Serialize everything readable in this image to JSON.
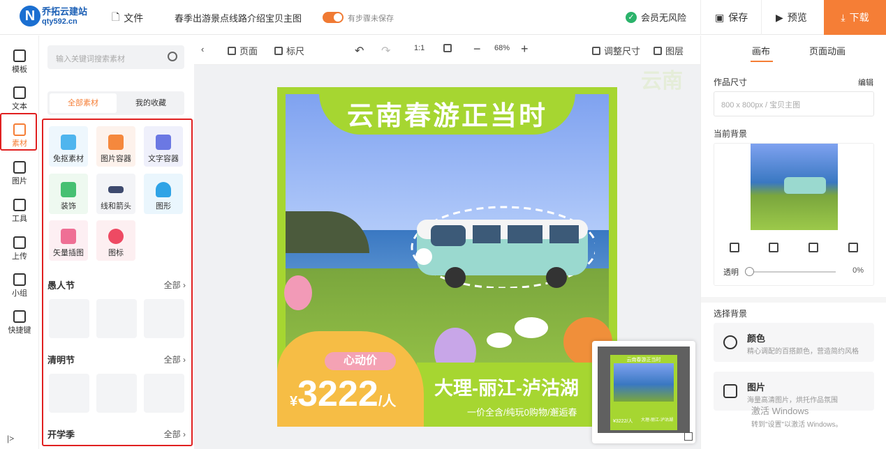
{
  "header": {
    "brand_name": "乔拓云建站",
    "brand_domain": "qty592.cn",
    "file_menu": "文件",
    "doc_name": "春季出游景点线路介绍宝贝主图",
    "unsaved": "有步骤未保存",
    "member_status": "会员无风险",
    "save": "保存",
    "preview": "预览",
    "download": "下载"
  },
  "rail": [
    {
      "label": "模板",
      "icon": "template-icon"
    },
    {
      "label": "文本",
      "icon": "text-icon"
    },
    {
      "label": "素材",
      "icon": "material-icon"
    },
    {
      "label": "图片",
      "icon": "image-icon"
    },
    {
      "label": "工具",
      "icon": "toolbox-icon"
    },
    {
      "label": "上传",
      "icon": "upload-icon"
    },
    {
      "label": "小组",
      "icon": "group-icon"
    },
    {
      "label": "快捷键",
      "icon": "keyboard-icon"
    }
  ],
  "panel": {
    "search_placeholder": "输入关键词搜索素材",
    "tab_all": "全部素材",
    "tab_fav": "我的收藏",
    "tiles": [
      "免抠素材",
      "图片容器",
      "文字容器",
      "装饰",
      "线和箭头",
      "图形",
      "矢量插图",
      "图标"
    ],
    "sections": [
      {
        "title": "愚人节",
        "more": "全部"
      },
      {
        "title": "清明节",
        "more": "全部"
      },
      {
        "title": "开学季",
        "more": "全部"
      }
    ]
  },
  "toolbar": {
    "page": "页面",
    "ruler": "标尺",
    "ratio": "1:1",
    "zoom": "68%",
    "resize": "调整尺寸",
    "layers": "图层"
  },
  "canvas": {
    "title": "云南春游正当时",
    "price_tag": "心动价",
    "currency": "¥",
    "price": "3222",
    "unit": "/人",
    "route": "大理-丽江-泸沽湖",
    "slogan": "一价全含/纯玩0购物/邂逅春",
    "mini_title": "云南春游正当时",
    "mini_price": "¥3222/人",
    "mini_route": "大理-丽江-泸沽湖",
    "watermark": "云南"
  },
  "props": {
    "tab_canvas": "画布",
    "tab_anim": "页面动画",
    "size_label": "作品尺寸",
    "edit": "编辑",
    "size_value": "800 x 800px   / 宝贝主图",
    "bg_label": "当前背景",
    "opacity_label": "透明",
    "opacity_value": "0%",
    "choose_bg": "选择背景",
    "color_title": "颜色",
    "color_desc": "精心调配的百搭颜色，营造简约风格",
    "image_title": "图片",
    "image_desc": "海量高清图片，烘托作品氛围"
  },
  "os_watermark": {
    "line1": "激活 Windows",
    "line2": "转到\"设置\"以激活 Windows。"
  },
  "colors": {
    "accent": "#f57e36",
    "canvas_green": "#a6d631",
    "highlight_red": "#e02020"
  }
}
